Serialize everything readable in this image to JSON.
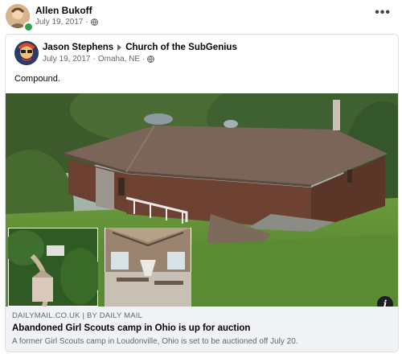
{
  "post": {
    "author": "Allen Bukoff",
    "date": "July 19, 2017",
    "privacy_icon": "globe-icon",
    "more_label": "•••"
  },
  "shared_post": {
    "author": "Jason Stephens",
    "group": "Church of the SubGenius",
    "date": "July 19, 2017",
    "separator": "·",
    "location": "Omaha, NE",
    "privacy_icon": "globe-icon",
    "text": "Compound."
  },
  "link_preview": {
    "domain": "DAILYMAIL.CO.UK | BY DAILY MAIL",
    "title": "Abandoned Girl Scouts camp in Ohio is up for auction",
    "description": "A former Girl Scouts camp in Loudonville, Ohio is set to be auctioned off July 20.",
    "info_label": "i"
  },
  "colors": {
    "online": "#31a24c",
    "meta_text": "#65676b",
    "card_bg": "#f0f2f5"
  }
}
